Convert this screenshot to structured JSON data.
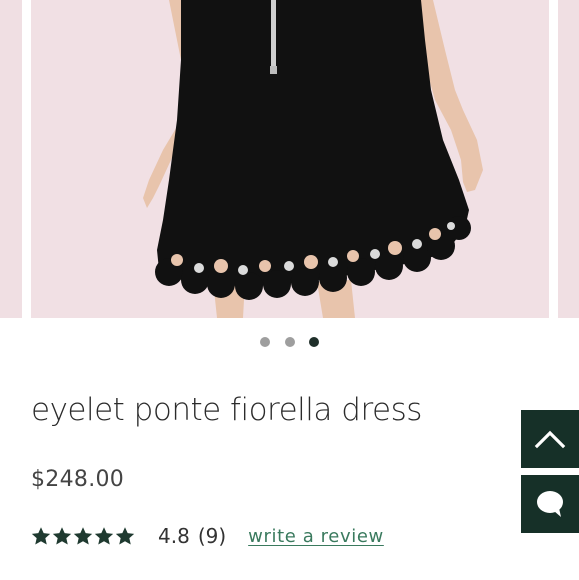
{
  "gallery": {
    "image_subject": "black scalloped eyelet dress back view",
    "total_slides": 3,
    "active_slide_index": 3,
    "backdrop_color": "#f1e0e4"
  },
  "product": {
    "title": "eyelet ponte fiorella dress",
    "price": "$248.00"
  },
  "rating": {
    "score": "4.8",
    "count": "(9)",
    "stars_filled": 5,
    "write_review_label": "write a review",
    "star_color": "#1f3a30",
    "link_color": "#3a7a5e"
  },
  "floating_buttons": {
    "back_to_top_icon": "chevron-up-icon",
    "chat_icon": "chat-bubble-icon",
    "color": "#163028"
  }
}
